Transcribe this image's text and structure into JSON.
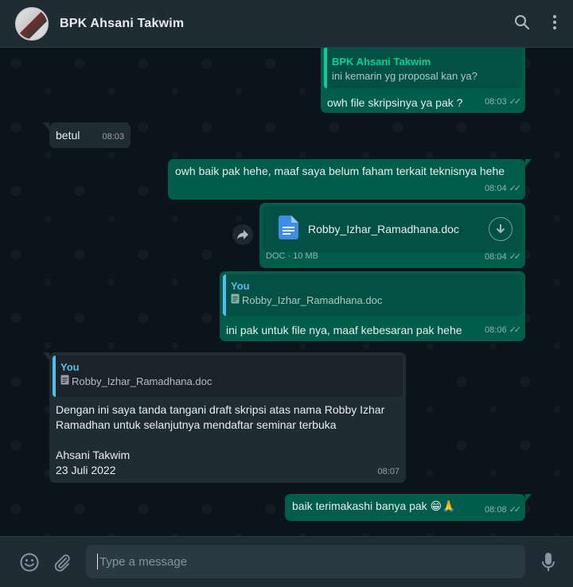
{
  "contact": {
    "name": "BPK Ahsani Takwim"
  },
  "colors": {
    "header": "#202c33",
    "chat_bg": "#0b141a",
    "outgoing": "#005c4b",
    "incoming": "#202c33",
    "accent_green": "#06cf9c",
    "accent_blue": "#53bdeb"
  },
  "messages": {
    "m1": {
      "quote_name": "BPK Ahsani Takwim",
      "quote_text": "ini kemarin yg proposal kan ya?",
      "text": "owh file skripsinya ya pak ?",
      "time": "08:03"
    },
    "m2": {
      "text": "betul",
      "time": "08:03"
    },
    "m3": {
      "text": "owh baik pak hehe, maaf saya belum faham terkait teknisnya hehe",
      "time": "08:04"
    },
    "m4": {
      "file_name": "Robby_Izhar_Ramadhana.doc",
      "file_info": "DOC · 10 MB",
      "time": "08:04"
    },
    "m5": {
      "quote_name": "You",
      "quote_file": "Robby_Izhar_Ramadhana.doc",
      "text": "ini pak untuk file nya, maaf kebesaran pak hehe",
      "time": "08:06"
    },
    "m6": {
      "quote_name": "You",
      "quote_file": "Robby_Izhar_Ramadhana.doc",
      "line1": "Dengan ini saya tanda tangani draft skripsi atas nama Robby Izhar",
      "line2": "Ramadhan untuk selanjutnya mendaftar seminar terbuka",
      "line3": "Ahsani Takwim",
      "line4": "23 Juli 2022",
      "time": "08:07"
    },
    "m7": {
      "text": "baik terimakashi banya pak",
      "emoji": "😁🙏",
      "time": "08:08"
    }
  },
  "composer": {
    "placeholder": "Type a message"
  },
  "icons": [
    "search-icon",
    "menu-icon",
    "emoji-icon",
    "attach-icon",
    "mic-icon",
    "document-icon",
    "download-icon",
    "forward-icon",
    "double-check-icon"
  ]
}
